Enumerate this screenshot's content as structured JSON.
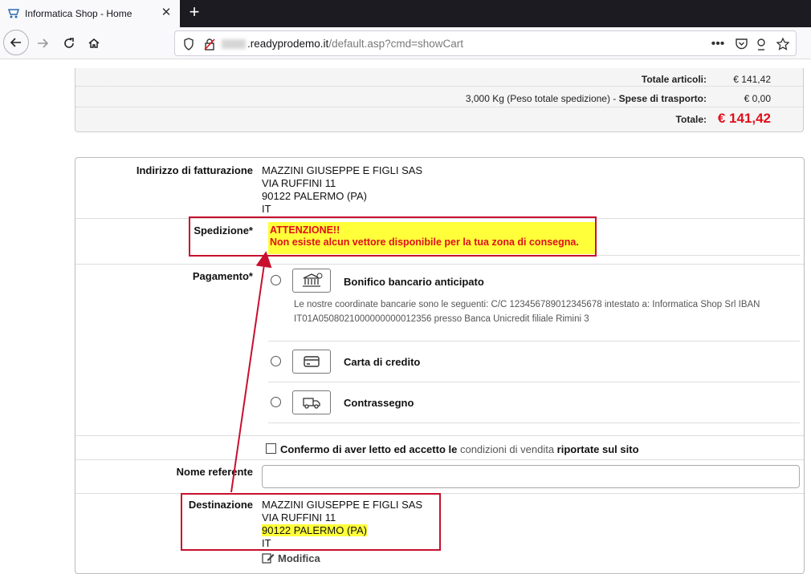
{
  "browser": {
    "tab_title": "Informatica Shop - Home",
    "url_host": ".readyprodemo.it",
    "url_path": "/default.asp?cmd=showCart"
  },
  "totals": {
    "items_label": "Totale articoli:",
    "items_value": "€ 141,42",
    "shipping_weight": "3,000 Kg (Peso totale spedizione) - ",
    "shipping_label": "Spese di trasporto:",
    "shipping_value": "€ 0,00",
    "total_label": "Totale:",
    "total_value": "€ 141,42"
  },
  "billing": {
    "label": "Indirizzo di fatturazione",
    "line1": "MAZZINI GIUSEPPE E FIGLI SAS",
    "line2": "VIA RUFFINI 11",
    "line3": "90122 PALERMO (PA)",
    "line4": "IT"
  },
  "shipping": {
    "label": "Spedizione*",
    "warning_title": "ATTENZIONE!!",
    "warning_text": "Non esiste alcun vettore disponibile per la tua zona di consegna."
  },
  "payment": {
    "label": "Pagamento*",
    "methods": [
      {
        "name": "Bonifico bancario anticipato",
        "icon": "bank-icon"
      },
      {
        "name": "Carta di credito",
        "icon": "credit-card-icon"
      },
      {
        "name": "Contrassegno",
        "icon": "delivery-truck-icon"
      }
    ],
    "bank_description": "Le nostre coordinate bancarie sono le seguenti: C/C 123456789012345678 intestato a: Informatica Shop Srl IBAN IT01A0508021000000000012356 presso Banca Unicredit filiale Rimini 3"
  },
  "consent": {
    "prefix": "Confermo di aver letto ed accetto le",
    "link": "condizioni di vendita",
    "suffix": "riportate sul sito"
  },
  "referent": {
    "label": "Nome referente",
    "value": ""
  },
  "destination": {
    "label": "Destinazione",
    "line1": "MAZZINI GIUSEPPE E FIGLI SAS",
    "line2": "VIA RUFFINI 11",
    "line3": "90122 PALERMO (PA)",
    "line4": "IT",
    "edit_label": "Modifica"
  },
  "colors": {
    "alert_red": "#e0101a",
    "highlight_yellow": "#ffff3a",
    "annotation_red": "#c8102e"
  }
}
